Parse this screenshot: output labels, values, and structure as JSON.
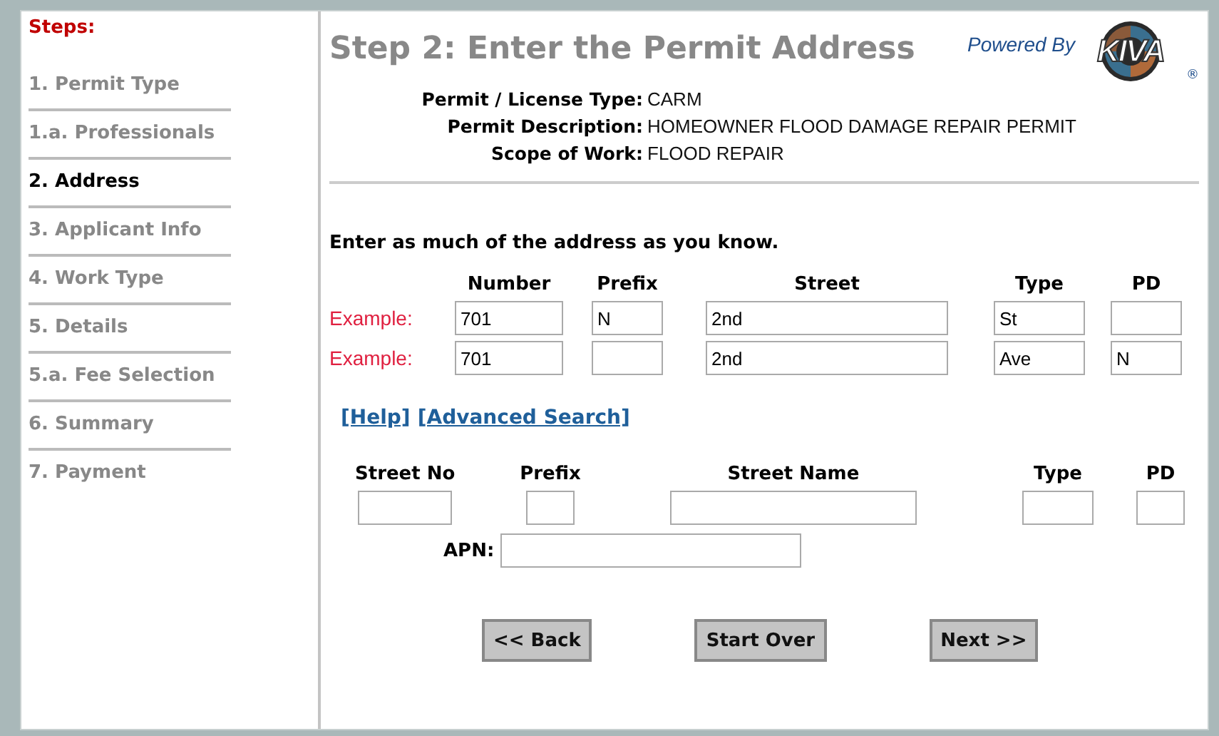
{
  "sidebar": {
    "heading": "Steps:",
    "items": [
      {
        "label": "1. Permit Type",
        "selected": false
      },
      {
        "label": "1.a. Professionals",
        "selected": false
      },
      {
        "label": "2. Address",
        "selected": true
      },
      {
        "label": "3. Applicant Info",
        "selected": false
      },
      {
        "label": "4. Work Type",
        "selected": false
      },
      {
        "label": "5. Details",
        "selected": false
      },
      {
        "label": "5.a. Fee Selection",
        "selected": false
      },
      {
        "label": "6. Summary",
        "selected": false
      },
      {
        "label": "7. Payment",
        "selected": false
      }
    ]
  },
  "title": "Step 2: Enter the Permit Address",
  "powered_by": {
    "text": "Powered By",
    "logo": "KIVA",
    "mark": "®"
  },
  "permit_info": [
    {
      "label": "Permit / License Type:",
      "value": "CARM"
    },
    {
      "label": "Permit Description:",
      "value": "HOMEOWNER FLOOD DAMAGE REPAIR PERMIT"
    },
    {
      "label": "Scope of Work:",
      "value": "FLOOD REPAIR"
    }
  ],
  "instruction": "Enter as much of the address as you know.",
  "example_columns": [
    "Number",
    "Prefix",
    "Street",
    "Type",
    "PD"
  ],
  "examples": [
    {
      "label": "Example:",
      "number": "701",
      "prefix": "N",
      "street": "2nd",
      "type": "St"
    },
    {
      "label": "Example:",
      "number": "701",
      "street": "2nd",
      "type": "Ave",
      "pd": "N"
    }
  ],
  "links": [
    "[Help]",
    "[Advanced Search]"
  ],
  "search_columns": [
    "Street No",
    "Prefix",
    "Street Name",
    "Type",
    "PD"
  ],
  "apn_label": "APN:",
  "buttons": [
    "<< Back",
    "Start Over",
    "Next >>"
  ]
}
